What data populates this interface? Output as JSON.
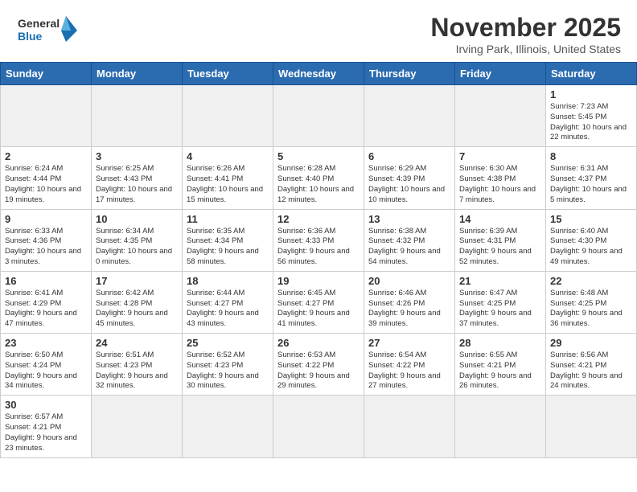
{
  "header": {
    "logo_general": "General",
    "logo_blue": "Blue",
    "month_title": "November 2025",
    "location": "Irving Park, Illinois, United States"
  },
  "weekdays": [
    "Sunday",
    "Monday",
    "Tuesday",
    "Wednesday",
    "Thursday",
    "Friday",
    "Saturday"
  ],
  "weeks": [
    [
      {
        "day": "",
        "info": ""
      },
      {
        "day": "",
        "info": ""
      },
      {
        "day": "",
        "info": ""
      },
      {
        "day": "",
        "info": ""
      },
      {
        "day": "",
        "info": ""
      },
      {
        "day": "",
        "info": ""
      },
      {
        "day": "1",
        "info": "Sunrise: 7:23 AM\nSunset: 5:45 PM\nDaylight: 10 hours\nand 22 minutes."
      }
    ],
    [
      {
        "day": "2",
        "info": "Sunrise: 6:24 AM\nSunset: 4:44 PM\nDaylight: 10 hours\nand 19 minutes."
      },
      {
        "day": "3",
        "info": "Sunrise: 6:25 AM\nSunset: 4:43 PM\nDaylight: 10 hours\nand 17 minutes."
      },
      {
        "day": "4",
        "info": "Sunrise: 6:26 AM\nSunset: 4:41 PM\nDaylight: 10 hours\nand 15 minutes."
      },
      {
        "day": "5",
        "info": "Sunrise: 6:28 AM\nSunset: 4:40 PM\nDaylight: 10 hours\nand 12 minutes."
      },
      {
        "day": "6",
        "info": "Sunrise: 6:29 AM\nSunset: 4:39 PM\nDaylight: 10 hours\nand 10 minutes."
      },
      {
        "day": "7",
        "info": "Sunrise: 6:30 AM\nSunset: 4:38 PM\nDaylight: 10 hours\nand 7 minutes."
      },
      {
        "day": "8",
        "info": "Sunrise: 6:31 AM\nSunset: 4:37 PM\nDaylight: 10 hours\nand 5 minutes."
      }
    ],
    [
      {
        "day": "9",
        "info": "Sunrise: 6:33 AM\nSunset: 4:36 PM\nDaylight: 10 hours\nand 3 minutes."
      },
      {
        "day": "10",
        "info": "Sunrise: 6:34 AM\nSunset: 4:35 PM\nDaylight: 10 hours\nand 0 minutes."
      },
      {
        "day": "11",
        "info": "Sunrise: 6:35 AM\nSunset: 4:34 PM\nDaylight: 9 hours\nand 58 minutes."
      },
      {
        "day": "12",
        "info": "Sunrise: 6:36 AM\nSunset: 4:33 PM\nDaylight: 9 hours\nand 56 minutes."
      },
      {
        "day": "13",
        "info": "Sunrise: 6:38 AM\nSunset: 4:32 PM\nDaylight: 9 hours\nand 54 minutes."
      },
      {
        "day": "14",
        "info": "Sunrise: 6:39 AM\nSunset: 4:31 PM\nDaylight: 9 hours\nand 52 minutes."
      },
      {
        "day": "15",
        "info": "Sunrise: 6:40 AM\nSunset: 4:30 PM\nDaylight: 9 hours\nand 49 minutes."
      }
    ],
    [
      {
        "day": "16",
        "info": "Sunrise: 6:41 AM\nSunset: 4:29 PM\nDaylight: 9 hours\nand 47 minutes."
      },
      {
        "day": "17",
        "info": "Sunrise: 6:42 AM\nSunset: 4:28 PM\nDaylight: 9 hours\nand 45 minutes."
      },
      {
        "day": "18",
        "info": "Sunrise: 6:44 AM\nSunset: 4:27 PM\nDaylight: 9 hours\nand 43 minutes."
      },
      {
        "day": "19",
        "info": "Sunrise: 6:45 AM\nSunset: 4:27 PM\nDaylight: 9 hours\nand 41 minutes."
      },
      {
        "day": "20",
        "info": "Sunrise: 6:46 AM\nSunset: 4:26 PM\nDaylight: 9 hours\nand 39 minutes."
      },
      {
        "day": "21",
        "info": "Sunrise: 6:47 AM\nSunset: 4:25 PM\nDaylight: 9 hours\nand 37 minutes."
      },
      {
        "day": "22",
        "info": "Sunrise: 6:48 AM\nSunset: 4:25 PM\nDaylight: 9 hours\nand 36 minutes."
      }
    ],
    [
      {
        "day": "23",
        "info": "Sunrise: 6:50 AM\nSunset: 4:24 PM\nDaylight: 9 hours\nand 34 minutes."
      },
      {
        "day": "24",
        "info": "Sunrise: 6:51 AM\nSunset: 4:23 PM\nDaylight: 9 hours\nand 32 minutes."
      },
      {
        "day": "25",
        "info": "Sunrise: 6:52 AM\nSunset: 4:23 PM\nDaylight: 9 hours\nand 30 minutes."
      },
      {
        "day": "26",
        "info": "Sunrise: 6:53 AM\nSunset: 4:22 PM\nDaylight: 9 hours\nand 29 minutes."
      },
      {
        "day": "27",
        "info": "Sunrise: 6:54 AM\nSunset: 4:22 PM\nDaylight: 9 hours\nand 27 minutes."
      },
      {
        "day": "28",
        "info": "Sunrise: 6:55 AM\nSunset: 4:21 PM\nDaylight: 9 hours\nand 26 minutes."
      },
      {
        "day": "29",
        "info": "Sunrise: 6:56 AM\nSunset: 4:21 PM\nDaylight: 9 hours\nand 24 minutes."
      }
    ],
    [
      {
        "day": "30",
        "info": "Sunrise: 6:57 AM\nSunset: 4:21 PM\nDaylight: 9 hours\nand 23 minutes."
      },
      {
        "day": "",
        "info": ""
      },
      {
        "day": "",
        "info": ""
      },
      {
        "day": "",
        "info": ""
      },
      {
        "day": "",
        "info": ""
      },
      {
        "day": "",
        "info": ""
      },
      {
        "day": "",
        "info": ""
      }
    ]
  ]
}
